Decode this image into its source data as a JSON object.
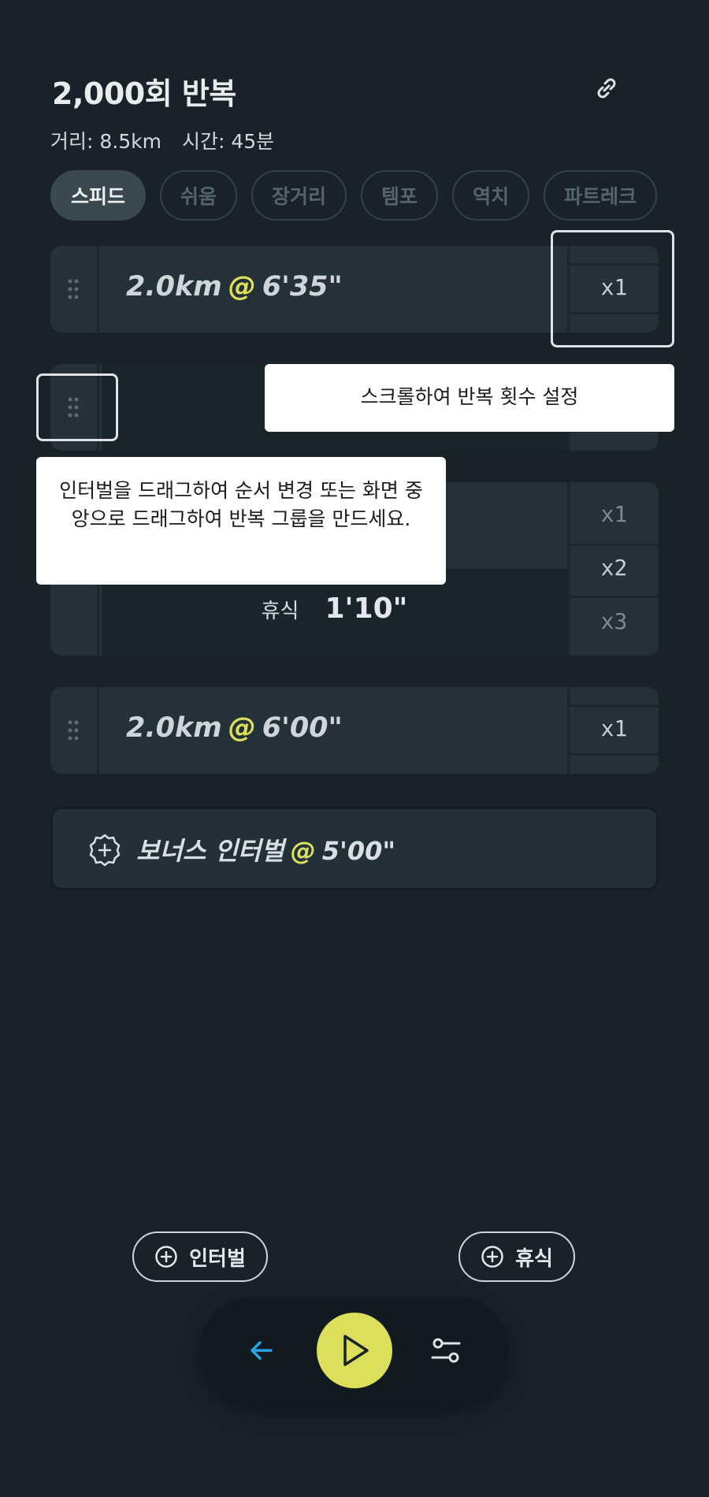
{
  "header": {
    "title": "2,000회 반복",
    "distance": "거리: 8.5km",
    "time": "시간: 45분"
  },
  "tags": [
    "스피드",
    "쉬움",
    "장거리",
    "템포",
    "역치",
    "파트레크"
  ],
  "intervals": [
    {
      "distance": "2.0km",
      "at": "@",
      "pace": "6'35\"",
      "reps": [
        "x1"
      ]
    },
    {
      "rest_label": "휴식",
      "rest_time": "1'10\"",
      "reps": [
        "x1",
        "x2",
        "x3"
      ]
    },
    {
      "distance": "2.0km",
      "at": "@",
      "pace": "6'00\"",
      "reps": [
        "x1"
      ]
    }
  ],
  "bonus": {
    "label": "보너스 인터벌",
    "at": "@",
    "pace": "5'00\""
  },
  "tooltips": {
    "scroll_reps": "스크롤하여 반복 횟수 설정",
    "drag_intervals": "인터벌을 드래그하여 순서 변경 또는 화면 중앙으로 드래그하여 반복 그룹을 만드세요."
  },
  "buttons": {
    "add_interval": "인터벌",
    "add_rest": "휴식"
  },
  "colors": {
    "background": "#182228",
    "accent": "#dcdf5b",
    "card": "#243139",
    "back_arrow": "#2aa3df"
  }
}
